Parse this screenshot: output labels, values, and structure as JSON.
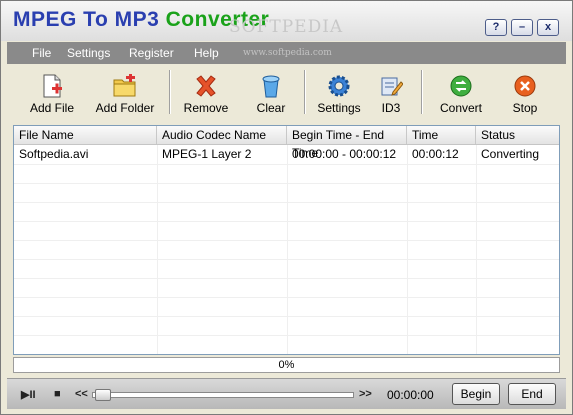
{
  "app": {
    "title_part1": "MPEG To MP3",
    "title_part2": "Converter",
    "watermark": "SOFTPEDIA",
    "watermark_url": "www.softpedia.com",
    "title_buttons": [
      "?",
      "–",
      "x"
    ]
  },
  "menu": [
    "File",
    "Settings",
    "Register",
    "Help"
  ],
  "toolbar": {
    "add_file": "Add File",
    "add_folder": "Add Folder",
    "remove": "Remove",
    "clear": "Clear",
    "settings": "Settings",
    "id3": "ID3",
    "convert": "Convert",
    "stop": "Stop"
  },
  "table": {
    "columns": [
      "File Name",
      "Audio Codec Name",
      "Begin Time - End Time",
      "Time",
      "Status"
    ],
    "rows": [
      {
        "file": "Softpedia.avi",
        "codec": "MPEG-1 Layer 2",
        "range": "00:00:00 - 00:00:12",
        "time": "00:00:12",
        "status": "Converting"
      }
    ]
  },
  "progress": {
    "text": "0%",
    "value": 0
  },
  "player": {
    "play_pause": "▶II",
    "stop": "■",
    "rewind": "<<",
    "forward": ">>",
    "time": "00:00:00",
    "begin": "Begin",
    "end": "End"
  },
  "colors": {
    "title_blue": "#2a3fb0",
    "title_green": "#1aa21a",
    "menubar": "#8a8a8a"
  }
}
